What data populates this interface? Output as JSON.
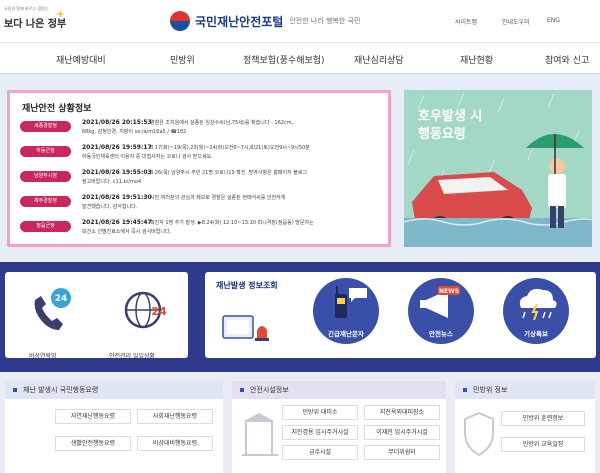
{
  "header": {
    "gov_tagline": "국민과 함께 바르고 힘있는",
    "gov_brand": "보다 나은 정부",
    "site_title": "국민재난안전포털",
    "site_slogan": "안전한 나라 행복한 국민",
    "util_links": [
      "사이트맵",
      "안내도우미",
      "ENG"
    ]
  },
  "gnb": {
    "items": [
      "재난예방대비",
      "민방위",
      "정책보험(풍수해보험)",
      "재난심리상담",
      "재난현황",
      "참여와 신고"
    ]
  },
  "status": {
    "title": "재난안전 상황정보",
    "rows": [
      {
        "badge": "세종경찰청",
        "date": "2021/08/26 20:15:53",
        "line1": "경찰은 조치원에서 실종된 임강수씨(남,75세)를 찾습니다 - 162cm,",
        "line2": "68kg, 감청인경, 지팡이 vo.la/m16a5 / ☎182"
      },
      {
        "badge": "하동군청",
        "date": "2021/08/26 19:59:17",
        "line1": "8.17(화)~19(목),23(월)~24(화)오전6~7시,8/21(토)오전9시~9시50분",
        "line2": "하동국민체육센터 이용자 중 미접사자는 코로나 검사 받으세요."
      },
      {
        "badge": "남양주시청",
        "date": "2021/08/26 19:55:03",
        "line1": "8.26(목) 남양주시 주민 21명 코로나19 확진. 방역사항은 홈페이지 블로그",
        "line2": "참고바랍니다. c11.kr/mo4"
      },
      {
        "badge": "제주경찰청",
        "date": "2021/08/26 19:51:30",
        "line1": "시민 여러분의 관심과 제보로 경찰은 실종된 현태석씨를 안전하게",
        "line2": "발견했습니다. 감사합니다."
      },
      {
        "badge": "정읍군청",
        "date": "2021/08/26 19:45:47",
        "line1": "확진자 1명 추가 발생. ▶8.24(화) 12:10~13:10 피니격장(정읍동) 방문자는",
        "line2": "보건소 선별진료소에서 즉시 검사바랍니다."
      }
    ]
  },
  "banner": {
    "line1": "호우발생 시",
    "line2": "행동요령"
  },
  "quick": [
    {
      "label": "비상연락망",
      "icon": "phone-24-icon"
    },
    {
      "label": "안전관리 일일상황",
      "icon": "globe-24-icon"
    }
  ],
  "info": {
    "title": "재난발생 정보조회",
    "circles": [
      {
        "label": "긴급재난문자",
        "icon": "radio-message-icon"
      },
      {
        "label": "안전뉴스",
        "icon": "news-megaphone-icon"
      },
      {
        "label": "기상특보",
        "icon": "rain-cloud-icon"
      }
    ]
  },
  "panels": {
    "disaster": {
      "title": "재난 발생시 국민행동요령",
      "items": [
        "자연재난행동요령",
        "사회재난행동요령",
        "생활안전행동요령",
        "비상대비행동요령"
      ]
    },
    "facility": {
      "title": "안전시설정보",
      "items": [
        "민방위 대피소",
        "지진옥외대피장소",
        "지진겸용 임시주거시설",
        "이재민 임시주거시설",
        "급수시설",
        "무더위쉼터"
      ]
    },
    "civil": {
      "title": "민방위 정보",
      "items": [
        "민방위 훈련정보",
        "민방위 교육일정"
      ]
    }
  },
  "colors": {
    "navy": "#2e3a8c",
    "pink_border": "#f2a3c1",
    "badge": "#c9285b",
    "banner": "#9ed4c2"
  }
}
